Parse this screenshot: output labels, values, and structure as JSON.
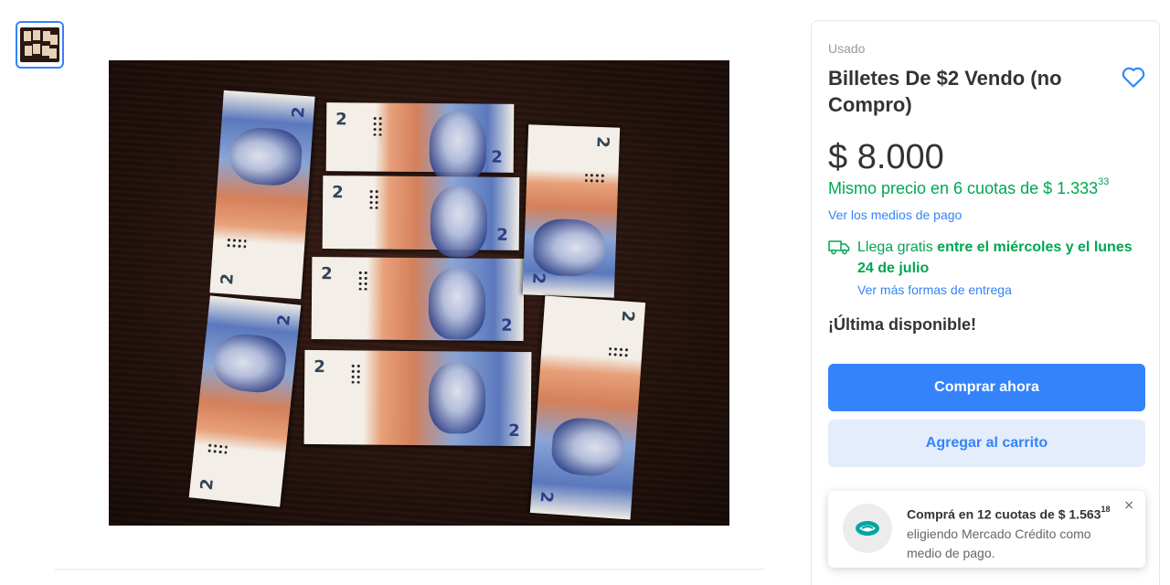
{
  "gallery": {
    "thumbnail_alt": "thumbnail-1",
    "main_image": "banknotes-photo"
  },
  "product": {
    "condition": "Usado",
    "title": "Billetes De $2 Vendo (no Compro)",
    "price": "$ 8.000",
    "installments_text": "Mismo precio en 6 cuotas de $ 1.333",
    "installments_cents": "33",
    "payment_methods_link": "Ver los medios de pago"
  },
  "shipping": {
    "prefix": "Llega gratis ",
    "dates": "entre el miércoles y el lunes 24 de julio",
    "more_options_link": "Ver más formas de entrega"
  },
  "stock_status": "¡Última disponible!",
  "actions": {
    "buy_now": "Comprar ahora",
    "add_to_cart": "Agregar al carrito"
  },
  "promo": {
    "headline": "Comprá en 12 cuotas de $ 1.563",
    "headline_cents": "18",
    "body": "eligiendo Mercado Crédito como medio de pago.",
    "close_label": "×"
  },
  "colors": {
    "accent": "#3483fa",
    "success": "#00a650",
    "secondary_button_bg": "#e3edfb"
  },
  "icons": {
    "favorite": "heart-icon",
    "shipping": "truck-icon",
    "promo": "mercado-credito-icon",
    "close": "close-icon"
  }
}
